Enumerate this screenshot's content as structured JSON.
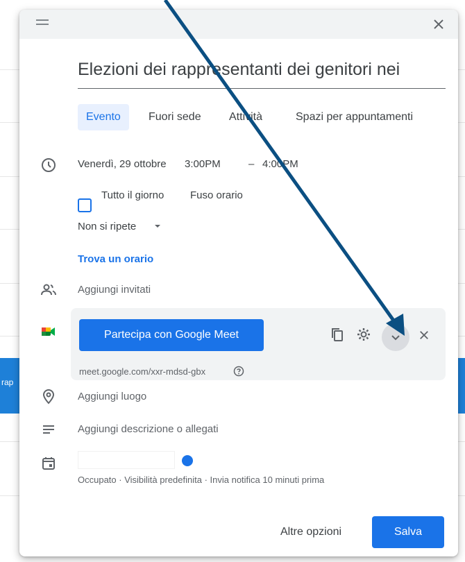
{
  "background": {
    "band_text": "rap"
  },
  "dialog": {
    "title": "Elezioni dei rappresentanti dei genitori nei",
    "tabs": [
      {
        "label": "Evento",
        "active": true
      },
      {
        "label": "Fuori sede",
        "active": false
      },
      {
        "label": "Attività",
        "active": false
      },
      {
        "label": "Spazi per appuntamenti",
        "active": false
      }
    ],
    "datetime": {
      "date": "Venerdì, 29 ottobre",
      "start": "3:00PM",
      "separator": "–",
      "end": "4:00PM"
    },
    "all_day_label": "Tutto il giorno",
    "timezone_label": "Fuso orario",
    "repeat": {
      "selected": "Non si ripete"
    },
    "find_time_label": "Trova un orario",
    "guests_placeholder": "Aggiungi invitati",
    "meet": {
      "button_label": "Partecipa con Google Meet",
      "link": "meet.google.com/xxr-mdsd-gbx"
    },
    "location_placeholder": "Aggiungi luogo",
    "description_placeholder": "Aggiungi descrizione o allegati",
    "calendar_details": "Occupato · Visibilità predefinita · Invia notifica 10 minuti prima",
    "more_options_label": "Altre opzioni",
    "save_label": "Salva"
  },
  "colors": {
    "accent": "#1a73e8",
    "annotation_arrow": "#0b4f82",
    "topbar": "#f1f3f4"
  },
  "icons": [
    "drag-handle-icon",
    "close-icon",
    "clock-icon",
    "people-icon",
    "google-meet-icon",
    "copy-icon",
    "gear-icon",
    "chevron-down-icon",
    "location-icon",
    "description-icon",
    "calendar-icon",
    "help-icon",
    "dropdown-arrow-icon"
  ]
}
